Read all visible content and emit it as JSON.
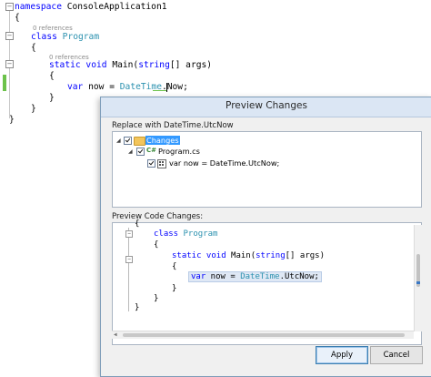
{
  "editor": {
    "lines": {
      "ns_kw": "namespace",
      "ns_name": " ConsoleApplication1",
      "brace_open": "{",
      "ref1": "0 references",
      "class_kw": "class",
      "class_name": " Program",
      "class_brace_open": "{",
      "ref2": "0 references",
      "static_kw": "static",
      "void_kw": " void",
      "main_sig_a": " Main(",
      "string_kw": "string",
      "main_sig_b": "[] args)",
      "method_brace_open": "{",
      "var_kw": "var",
      "var_rest_a": " now = ",
      "datetime_type": "DateTime",
      "var_rest_b": ".Now;",
      "method_brace_close": "}",
      "class_brace_close": "}",
      "brace_close": "}"
    }
  },
  "dialog": {
    "title": "Preview Changes",
    "replace_label": "Replace with DateTime.UtcNow",
    "tree": {
      "root": "Changes",
      "file": "Program.cs",
      "change": "var now = DateTime.UtcNow;"
    },
    "preview_label": "Preview Code Changes:",
    "preview": {
      "brace_top": "{",
      "class_kw": "class",
      "class_name": " Program",
      "class_brace_open": "{",
      "static_kw": "static",
      "void_kw": " void",
      "main_a": " Main(",
      "string_kw": "string",
      "main_b": "[] args)",
      "method_brace_open": "{",
      "var_kw": "var",
      "var_a": " now = ",
      "datetime_type": "DateTime",
      "var_b": ".UtcNow;",
      "method_brace_close": "}",
      "class_brace_close": "}",
      "brace_bottom": "}"
    },
    "buttons": {
      "apply": "Apply",
      "cancel": "Cancel"
    }
  },
  "colors": {
    "keyword": "#0000ff",
    "type": "#2b91af",
    "selection": "#3399ff",
    "change_marker": "#6cc24a"
  },
  "icons": {
    "collapse": "minus-box-icon",
    "folder": "folder-icon",
    "csharp_file": "csharp-file-icon",
    "variable": "variable-icon",
    "checkbox": "checkbox-checked-icon"
  }
}
